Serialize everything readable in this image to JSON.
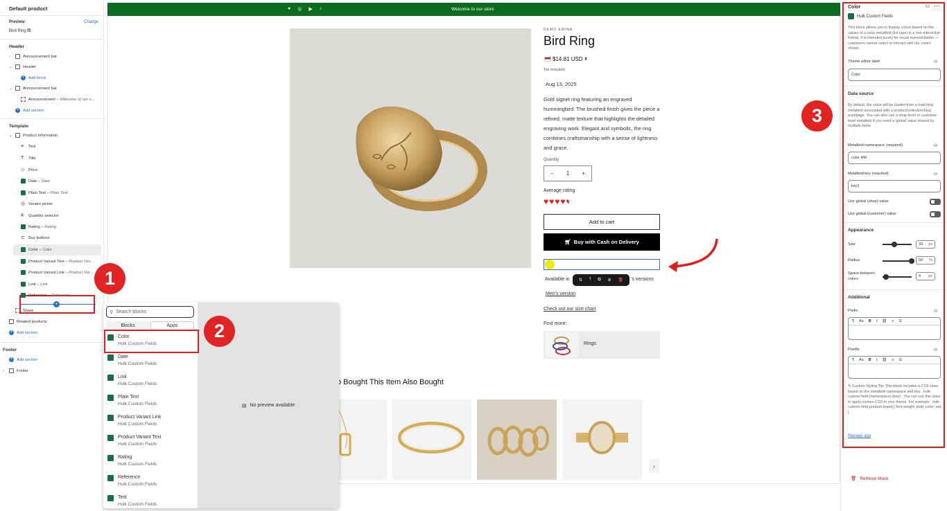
{
  "left": {
    "title": "Default product",
    "preview_label": "Preview",
    "change_label": "Change",
    "preview_value": "Bird Ring",
    "header_section": "Header",
    "items_header": [
      {
        "label": "Announcement bar",
        "sub": ""
      },
      {
        "label": "Header",
        "sub": ""
      },
      {
        "label": "Add block",
        "sub": ""
      },
      {
        "label": "Announcement bar",
        "sub": ""
      },
      {
        "label": "Announcement",
        "sub": "Welcome to our s..."
      },
      {
        "label": "Add section",
        "sub": ""
      }
    ],
    "template_section": "Template",
    "product_info": "Product information",
    "blocks": [
      {
        "label": "Text",
        "sub": ""
      },
      {
        "label": "Title",
        "sub": ""
      },
      {
        "label": "Price",
        "sub": ""
      },
      {
        "label": "Date",
        "sub": "Date"
      },
      {
        "label": "Plain Text",
        "sub": "Plain Text"
      },
      {
        "label": "Variant picker",
        "sub": ""
      },
      {
        "label": "Quantity selector",
        "sub": ""
      },
      {
        "label": "Rating",
        "sub": "Rating"
      },
      {
        "label": "Buy buttons",
        "sub": ""
      },
      {
        "label": "Color",
        "sub": "Color"
      },
      {
        "label": "Product Variant Text",
        "sub": "Product Vari..."
      },
      {
        "label": "Product Variant Link",
        "sub": "Product Var..."
      },
      {
        "label": "Link",
        "sub": "Link"
      },
      {
        "label": "Reference",
        "sub": "Reference"
      }
    ],
    "share": "Share",
    "related": "Related products",
    "add_section": "Add section",
    "footer_section": "Footer",
    "footer_add_section": "Add section",
    "footer_item": "Footer"
  },
  "store": {
    "announcement": "Welcome to our store",
    "vendor": "DEMO EMINA",
    "product_title": "Bird Ring",
    "price": "$14.81 USD",
    "tax": "Tax included.",
    "date": "Aug 13, 2025",
    "description": "Gold signet ring featuring an engraved hummingbird. The brushed finish gives the piece a refined, matte texture that highlights the detailed engraving work. Elegant and symbolic, the ring combines craftsmanship with a sense of lightness and grace.",
    "quantity_label": "Quantity",
    "quantity_minus": "−",
    "quantity_value": "1",
    "quantity_plus": "+",
    "rating_label": "Average rating",
    "rating_value": 4.5,
    "add_to_cart": "Add to cart",
    "buy_cod": "Buy with Cash on Delivery",
    "available_in": "Available in",
    "versions_suffix": "'s versions",
    "mens_version": "Men's version",
    "size_chart": "Check out our size chart",
    "find_more": "Find more:",
    "find_more_item": "Rings",
    "also_bought": "o Bought This Item Also Bought",
    "no_preview": "No preview available"
  },
  "popup": {
    "search_placeholder": "Search blocks",
    "tab_blocks": "Blocks",
    "tab_apps": "Apps",
    "items": [
      {
        "name": "Color",
        "sub": "Hulk Custom Fields"
      },
      {
        "name": "Date",
        "sub": "Hulk Custom Fields"
      },
      {
        "name": "Link",
        "sub": "Hulk Custom Fields"
      },
      {
        "name": "Plain Text",
        "sub": "Hulk Custom Fields"
      },
      {
        "name": "Product Variant Link",
        "sub": "Hulk Custom Fields"
      },
      {
        "name": "Product Variant Text",
        "sub": "Hulk Custom Fields"
      },
      {
        "name": "Rating",
        "sub": "Hulk Custom Fields"
      },
      {
        "name": "Reference",
        "sub": "Hulk Custom Fields"
      },
      {
        "name": "Text",
        "sub": "Hulk Custom Fields"
      }
    ]
  },
  "right": {
    "title": "Color",
    "app_name": "Hulk Custom Fields",
    "description": "This block allows you to display colors based on the values of a color metafield (list type) in a non-interactive format. It is intended purely for visual representation — customers cannot select or interact with the colors shown.",
    "theme_label_title": "Theme editor label",
    "theme_label_value": "Color",
    "data_source_title": "Data source",
    "data_source_desc": "By default, the value will be loaded from a matching metafield associated with a product/collection/blog post/page. You can also use a shop-level or customer-level metafield if you need a 'global' value shared by multiple items.",
    "ns_label": "Metafield namespace (required)",
    "ns_value": "color HM",
    "key_label": "Metafield key (required)",
    "key_value": "key1",
    "global_shop": "Use global (shop) value",
    "global_customer": "Use global (customer) value",
    "appearance_title": "Appearance",
    "size_label": "Size",
    "size_value": "33",
    "radius_label": "Radius",
    "radius_value": "50",
    "space_label": "Space between colors",
    "space_value": "4",
    "unit_px": "px",
    "unit_pct": "%",
    "additional_title": "Additional",
    "prefix_label": "Prefix",
    "postfix_label": "Postfix",
    "tip": "Custom Styling Tip: This block includes a CSS class based on the metafield namespace and key: .hulk-custom-field-{namespace}-{key} . You can use this class to apply custom CSS in your theme. For example: .hulk-custom-field-product-brand { font-weight: bold; color: red; }",
    "manage_app": "Manage app",
    "remove_block": "Remove block"
  },
  "badges": {
    "one": "1",
    "two": "2",
    "three": "3"
  },
  "colors": {
    "accent_red": "#e11c1c",
    "store_green": "#0b6b1f",
    "link_blue": "#2c6ecb"
  }
}
